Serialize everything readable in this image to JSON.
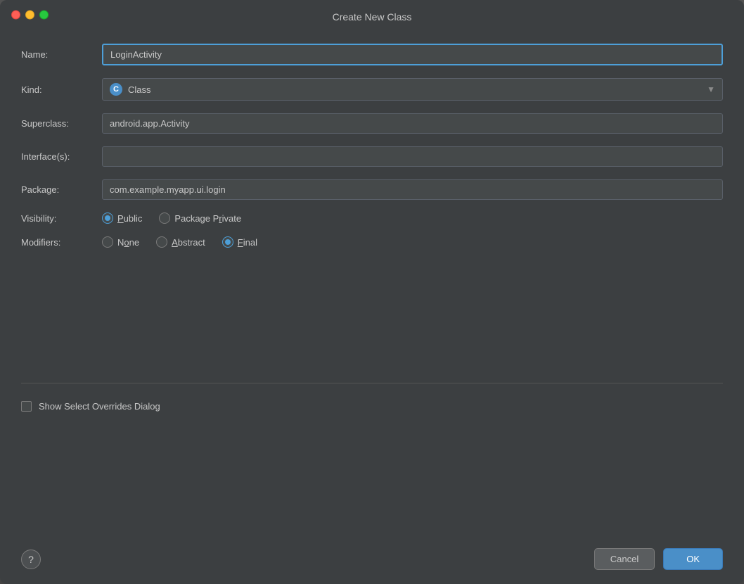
{
  "dialog": {
    "title": "Create New Class"
  },
  "form": {
    "name_label": "Name:",
    "name_value": "LoginActivity",
    "kind_label": "Kind:",
    "kind_value": "Class",
    "kind_badge": "C",
    "superclass_label": "Superclass:",
    "superclass_value": "android.app.Activity",
    "interfaces_label": "Interface(s):",
    "interfaces_value": "",
    "package_label": "Package:",
    "package_value": "com.example.myapp.ui.login",
    "visibility_label": "Visibility:",
    "visibility_options": [
      {
        "id": "public",
        "label": "Public",
        "checked": true,
        "underline": "u"
      },
      {
        "id": "package-private",
        "label": "Package Private",
        "checked": false,
        "underline": "r"
      }
    ],
    "modifiers_label": "Modifiers:",
    "modifiers_options": [
      {
        "id": "none",
        "label": "None",
        "checked": false,
        "underline": "o"
      },
      {
        "id": "abstract",
        "label": "Abstract",
        "checked": false,
        "underline": "A"
      },
      {
        "id": "final",
        "label": "Final",
        "checked": true,
        "underline": "F"
      }
    ],
    "checkbox_label": "Show Select Overrides Dialog",
    "checkbox_checked": false
  },
  "buttons": {
    "help": "?",
    "cancel": "Cancel",
    "ok": "OK"
  }
}
